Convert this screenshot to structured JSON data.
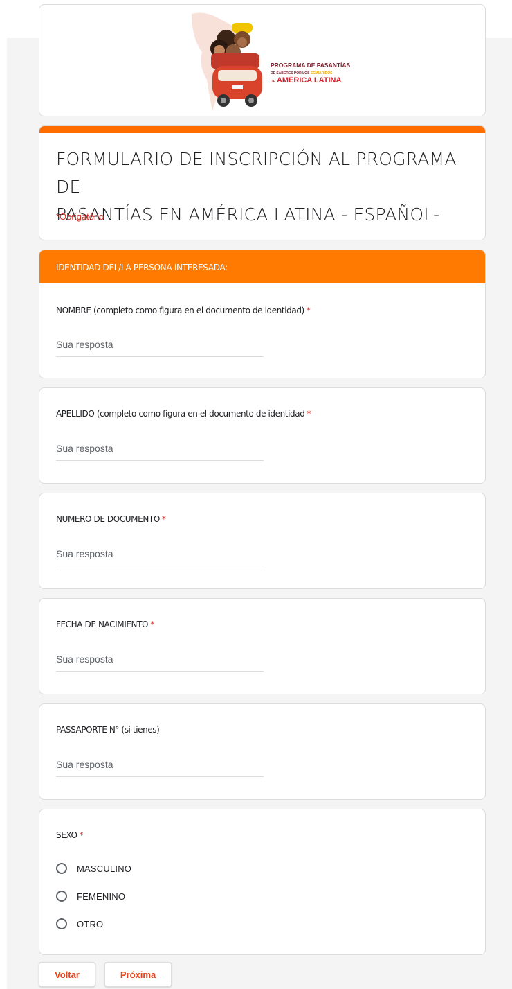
{
  "banner": {
    "logo_line1": "PROGRAMA DE PASANTÍAS",
    "logo_line2a": "DE SABERES POR LOS ",
    "logo_line2b": "SEMIÁRIDOS",
    "logo_line3a": "DE",
    "logo_line3b": "AMÉRICA LATINA"
  },
  "form": {
    "title_line1": "FORMULARIO DE INSCRIPCIÓN AL PROGRAMA DE",
    "title_line2": "PASANTÍAS EN AMÉRICA LATINA - ESPAÑOL-",
    "required_note": "*Obrigatório"
  },
  "section": {
    "title": "IDENTIDAD DEL/LA PERSONA INTERESADA:"
  },
  "questions": {
    "nombre": {
      "label": "NOMBRE (completo como figura en el documento de identidad)",
      "star": "*",
      "placeholder": "Sua resposta"
    },
    "apellido": {
      "label": "APELLIDO (completo como figura en el documento de identidad",
      "star": "*",
      "placeholder": "Sua resposta"
    },
    "documento": {
      "label": "NUMERO DE DOCUMENTO",
      "star": "*",
      "placeholder": "Sua resposta"
    },
    "fecha": {
      "label": "FECHA DE NACIMIENTO",
      "star": "*",
      "placeholder": "Sua resposta"
    },
    "pasaporte": {
      "label": "PASSAPORTE N° (si tienes)",
      "placeholder": "Sua resposta"
    },
    "sexo": {
      "label": "SEXO",
      "star": "*",
      "options": [
        "MASCULINO",
        "FEMENINO",
        "OTRO"
      ]
    }
  },
  "nav": {
    "back": "Voltar",
    "next": "Próxima"
  },
  "colors": {
    "accent": "#ff7a00",
    "required": "#d93025",
    "button_text": "#e8431a"
  }
}
